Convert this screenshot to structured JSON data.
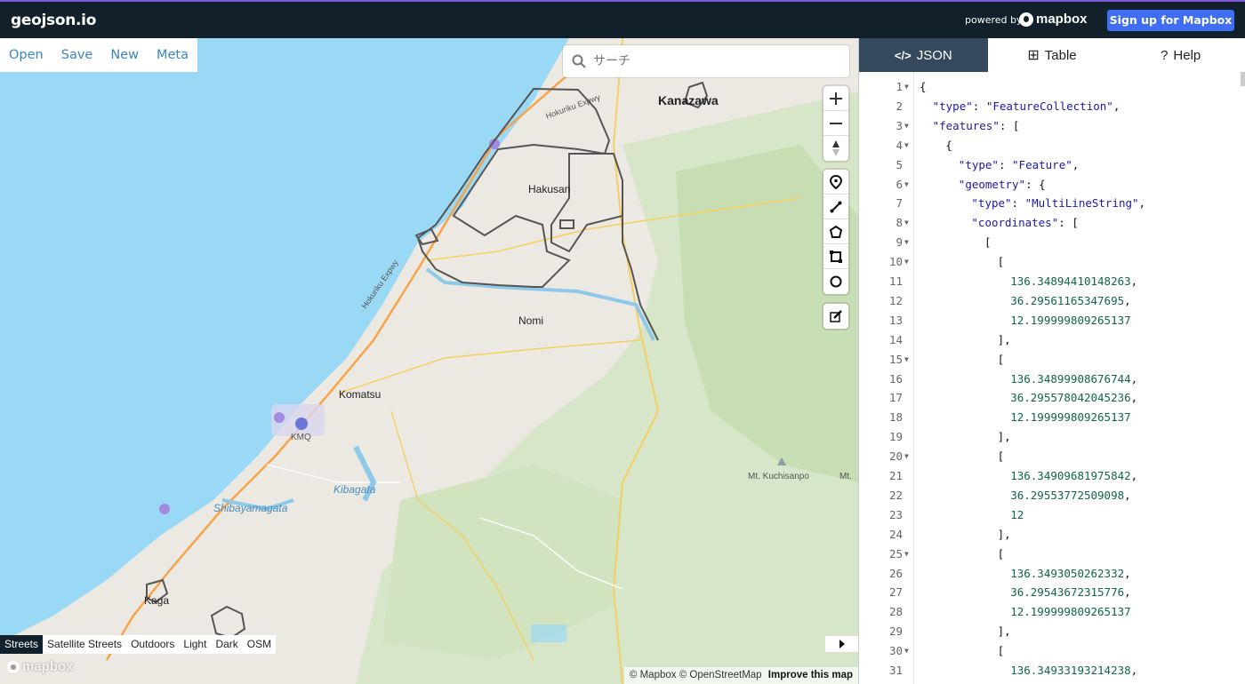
{
  "header": {
    "brand": "geojson.io",
    "powered_by": "powered by",
    "mapbox_logo": "mapbox",
    "signup": "Sign up for Mapbox"
  },
  "filemenu": [
    "Open",
    "Save",
    "New",
    "Meta"
  ],
  "search": {
    "placeholder": "サーチ"
  },
  "map_labels": {
    "kanazawa": "Kanazawa",
    "hakusan": "Hakusan",
    "nomi": "Nomi",
    "komatsu": "Komatsu",
    "kmq": "KMQ",
    "kibagata": "Kibagata",
    "shibayamagata": "Shibayamagata",
    "kaga": "Kaga",
    "kuchisanpo": "Mt. Kuchisanpo",
    "mt": "Mt.",
    "hokuriku1": "Hokuriku Expwy",
    "hokuriku2": "Hokuriku Expwy"
  },
  "styles": [
    "Streets",
    "Satellite Streets",
    "Outdoors",
    "Light",
    "Dark",
    "OSM"
  ],
  "styles_active": "Streets",
  "attribution": {
    "mapbox": "© Mapbox",
    "osm": "© OpenStreetMap",
    "improve": "Improve this map"
  },
  "watermark": "mapbox",
  "tabs": [
    {
      "icon": "</>",
      "label": "JSON"
    },
    {
      "icon": "⊞",
      "label": "Table"
    },
    {
      "icon": "?",
      "label": "Help"
    }
  ],
  "code_lines": [
    {
      "n": "1",
      "fold": true,
      "indent": 0,
      "parts": [
        [
          "p",
          "{"
        ]
      ]
    },
    {
      "n": "2",
      "fold": false,
      "indent": 1,
      "parts": [
        [
          "k",
          "\"type\""
        ],
        [
          "p",
          ": "
        ],
        [
          "s",
          "\"FeatureCollection\""
        ],
        [
          "p",
          ","
        ]
      ]
    },
    {
      "n": "3",
      "fold": true,
      "indent": 1,
      "parts": [
        [
          "k",
          "\"features\""
        ],
        [
          "p",
          ": ["
        ]
      ]
    },
    {
      "n": "4",
      "fold": true,
      "indent": 2,
      "parts": [
        [
          "p",
          "{"
        ]
      ]
    },
    {
      "n": "5",
      "fold": false,
      "indent": 3,
      "parts": [
        [
          "k",
          "\"type\""
        ],
        [
          "p",
          ": "
        ],
        [
          "s",
          "\"Feature\""
        ],
        [
          "p",
          ","
        ]
      ]
    },
    {
      "n": "6",
      "fold": true,
      "indent": 3,
      "parts": [
        [
          "k",
          "\"geometry\""
        ],
        [
          "p",
          ": {"
        ]
      ]
    },
    {
      "n": "7",
      "fold": false,
      "indent": 4,
      "parts": [
        [
          "k",
          "\"type\""
        ],
        [
          "p",
          ": "
        ],
        [
          "s",
          "\"MultiLineString\""
        ],
        [
          "p",
          ","
        ]
      ]
    },
    {
      "n": "8",
      "fold": true,
      "indent": 4,
      "parts": [
        [
          "k",
          "\"coordinates\""
        ],
        [
          "p",
          ": ["
        ]
      ]
    },
    {
      "n": "9",
      "fold": true,
      "indent": 5,
      "parts": [
        [
          "p",
          "["
        ]
      ]
    },
    {
      "n": "10",
      "fold": true,
      "indent": 6,
      "parts": [
        [
          "p",
          "["
        ]
      ]
    },
    {
      "n": "11",
      "fold": false,
      "indent": 7,
      "parts": [
        [
          "n",
          "136.34894410148263"
        ],
        [
          "p",
          ","
        ]
      ]
    },
    {
      "n": "12",
      "fold": false,
      "indent": 7,
      "parts": [
        [
          "n",
          "36.29561165347695"
        ],
        [
          "p",
          ","
        ]
      ]
    },
    {
      "n": "13",
      "fold": false,
      "indent": 7,
      "parts": [
        [
          "n",
          "12.199999809265137"
        ]
      ]
    },
    {
      "n": "14",
      "fold": false,
      "indent": 6,
      "parts": [
        [
          "p",
          "],"
        ]
      ]
    },
    {
      "n": "15",
      "fold": true,
      "indent": 6,
      "parts": [
        [
          "p",
          "["
        ]
      ]
    },
    {
      "n": "16",
      "fold": false,
      "indent": 7,
      "parts": [
        [
          "n",
          "136.34899908676744"
        ],
        [
          "p",
          ","
        ]
      ]
    },
    {
      "n": "17",
      "fold": false,
      "indent": 7,
      "parts": [
        [
          "n",
          "36.295578042045236"
        ],
        [
          "p",
          ","
        ]
      ]
    },
    {
      "n": "18",
      "fold": false,
      "indent": 7,
      "parts": [
        [
          "n",
          "12.199999809265137"
        ]
      ]
    },
    {
      "n": "19",
      "fold": false,
      "indent": 6,
      "parts": [
        [
          "p",
          "],"
        ]
      ]
    },
    {
      "n": "20",
      "fold": true,
      "indent": 6,
      "parts": [
        [
          "p",
          "["
        ]
      ]
    },
    {
      "n": "21",
      "fold": false,
      "indent": 7,
      "parts": [
        [
          "n",
          "136.34909681975842"
        ],
        [
          "p",
          ","
        ]
      ]
    },
    {
      "n": "22",
      "fold": false,
      "indent": 7,
      "parts": [
        [
          "n",
          "36.29553772509098"
        ],
        [
          "p",
          ","
        ]
      ]
    },
    {
      "n": "23",
      "fold": false,
      "indent": 7,
      "parts": [
        [
          "n",
          "12"
        ]
      ]
    },
    {
      "n": "24",
      "fold": false,
      "indent": 6,
      "parts": [
        [
          "p",
          "],"
        ]
      ]
    },
    {
      "n": "25",
      "fold": true,
      "indent": 6,
      "parts": [
        [
          "p",
          "["
        ]
      ]
    },
    {
      "n": "26",
      "fold": false,
      "indent": 7,
      "parts": [
        [
          "n",
          "136.3493050262332"
        ],
        [
          "p",
          ","
        ]
      ]
    },
    {
      "n": "27",
      "fold": false,
      "indent": 7,
      "parts": [
        [
          "n",
          "36.29543672315776"
        ],
        [
          "p",
          ","
        ]
      ]
    },
    {
      "n": "28",
      "fold": false,
      "indent": 7,
      "parts": [
        [
          "n",
          "12.199999809265137"
        ]
      ]
    },
    {
      "n": "29",
      "fold": false,
      "indent": 6,
      "parts": [
        [
          "p",
          "],"
        ]
      ]
    },
    {
      "n": "30",
      "fold": true,
      "indent": 6,
      "parts": [
        [
          "p",
          "["
        ]
      ]
    },
    {
      "n": "31",
      "fold": false,
      "indent": 7,
      "parts": [
        [
          "n",
          "136.34933193214238"
        ],
        [
          "p",
          ","
        ]
      ]
    }
  ],
  "colors": {
    "accent": "#3f6ef4",
    "topbar": "#11202b",
    "tab_active": "#34495e",
    "link": "#3a86bf",
    "water": "#9ad9f6"
  }
}
